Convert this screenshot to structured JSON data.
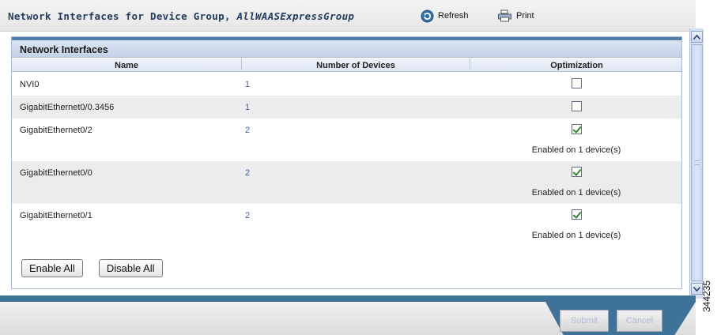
{
  "header": {
    "title_prefix": "Network Interfaces for Device Group,",
    "title_group": "AllWAASExpressGroup",
    "refresh_label": "Refresh",
    "print_label": "Print"
  },
  "panel": {
    "title": "Network Interfaces",
    "columns": [
      "Name",
      "Number of Devices",
      "Optimization"
    ],
    "rows": [
      {
        "name": "NVI0",
        "devices": "1",
        "optimization_checked": false,
        "note": ""
      },
      {
        "name": "GigabitEthernet0/0.3456",
        "devices": "1",
        "optimization_checked": false,
        "note": ""
      },
      {
        "name": "GigabitEthernet0/2",
        "devices": "2",
        "optimization_checked": true,
        "note": "Enabled on 1 device(s)"
      },
      {
        "name": "GigabitEthernet0/0",
        "devices": "2",
        "optimization_checked": true,
        "note": "Enabled on 1 device(s)"
      },
      {
        "name": "GigabitEthernet0/1",
        "devices": "2",
        "optimization_checked": true,
        "note": "Enabled on 1 device(s)"
      }
    ],
    "enable_all_label": "Enable All",
    "disable_all_label": "Disable All"
  },
  "footer": {
    "submit_label": "Submit",
    "cancel_label": "Cancel"
  },
  "figure_id": "344235",
  "colors": {
    "accent": "#3e7298",
    "panel_header": "#c3d1e8",
    "link": "#3f62b8",
    "check": "#2f8a2f"
  }
}
